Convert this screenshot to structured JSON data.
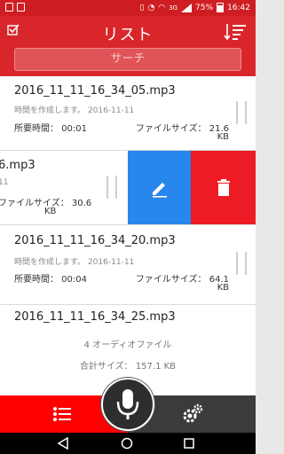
{
  "status_bar": {
    "network": "3G",
    "battery": "75%",
    "time": "16:42"
  },
  "toolbar": {
    "title": "リスト",
    "search_placeholder": "サーチ"
  },
  "items": [
    {
      "name": "2016_11_11_16_34_05.mp3",
      "created": "時間を作成します。 2016-11-11",
      "duration": "所要時間： 00:01",
      "size_line1": "ファイルサイズ： 21.6",
      "size_line2": "KB"
    },
    {
      "name": "6.mp3",
      "created": "11",
      "size_line1": "ファイルサイズ： 30.6",
      "size_line2": "KB"
    },
    {
      "name": "2016_11_11_16_34_20.mp3",
      "created": "時間を作成します。 2016-11-11",
      "duration": "所要時間： 00:04",
      "size_line1": "ファイルサイズ： 64.1",
      "size_line2": "KB"
    },
    {
      "name": "2016_11_11_16_34_25.mp3"
    }
  ],
  "summary": {
    "count": "4 オーディオファイル",
    "total_size": "合計サイズ： 157.1 KB"
  },
  "colors": {
    "toolbar": "#d9262b",
    "status_bar": "#cf1e23",
    "edit": "#2887ec",
    "delete": "#ec1b24",
    "tab_active": "#ff0000",
    "tab_inactive": "#3b3b3b"
  },
  "icons": [
    "checkbox-icon",
    "sort-icon",
    "edit-icon",
    "trash-icon",
    "list-icon",
    "microphone-icon",
    "settings-icon",
    "back-icon",
    "home-icon",
    "recents-icon"
  ]
}
